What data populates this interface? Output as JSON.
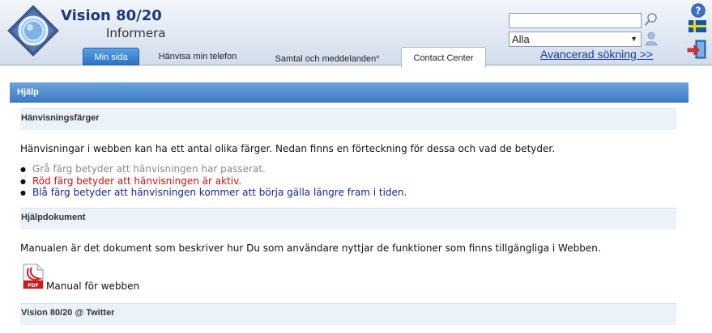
{
  "app": {
    "title": "Vision 80/20",
    "subtitle": "Informera"
  },
  "tabs": [
    {
      "label": "Min sida",
      "state": "active"
    },
    {
      "label": "Hänvisa min telefon",
      "state": "normal"
    },
    {
      "label": "Samtal och meddelanden",
      "state": "normal",
      "marker": "*"
    },
    {
      "label": "Contact Center",
      "state": "current"
    }
  ],
  "search": {
    "value": "",
    "placeholder": "",
    "scope_selected": "Alla",
    "advanced_link": "Avancerad sökning >>"
  },
  "icons": {
    "help": "help-icon",
    "language": "swedish-flag-icon",
    "logout": "logout-icon",
    "search": "search-icon",
    "person": "person-icon",
    "pdf": "pdf-icon"
  },
  "colors": {
    "brand_blue": "#1a3a7a",
    "section_bar": "#4a86cc",
    "sub_header_bg": "#ebf2fa",
    "gray_status": "#8a8a8a",
    "red_status": "#cc1111",
    "blue_status": "#14249a"
  },
  "content": {
    "section_title": "Hjälp",
    "colors_header": "Hänvisningsfärger",
    "colors_intro": "Hänvisningar i webben kan ha ett antal olika färger. Nedan finns en förteckning för dessa och vad de betyder.",
    "color_items": [
      "Grå färg betyder att hänvisningen har passerat.",
      "Röd färg betyder att hänvisningen är aktiv.",
      "Blå färg betyder att hänvisningen kommer att börja gälla längre fram i tiden."
    ],
    "docs_header": "Hjälpdokument",
    "docs_intro": "Manualen är det dokument som beskriver hur Du som användare nyttjar de funktioner som finns tillgängliga i Webben.",
    "manual_link": "Manual för webben",
    "twitter_header": "Vision 80/20 @ Twitter"
  }
}
